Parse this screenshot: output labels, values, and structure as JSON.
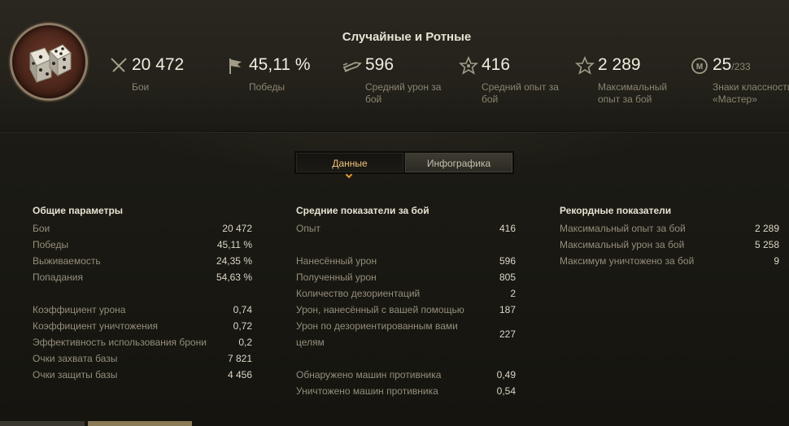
{
  "header": {
    "mode_title": "Случайные и Ротные",
    "stats": [
      {
        "icon": "crossed-swords-icon",
        "value": "20 472",
        "label": "Бои"
      },
      {
        "icon": "flag-icon",
        "value": "45,11 %",
        "label": "Победы"
      },
      {
        "icon": "shell-icon",
        "value": "596",
        "label_line1": "Средний урон за",
        "label_line2": "бой"
      },
      {
        "icon": "star-icon",
        "value": "416",
        "label_line1": "Средний опыт за",
        "label_line2": "бой"
      },
      {
        "icon": "star-outline-icon",
        "value": "2 289",
        "label_line1": "Максимальный",
        "label_line2": "опыт за бой"
      },
      {
        "icon": "mastery-badge-icon",
        "value": "25",
        "value_suffix": "/233",
        "label_line1": "Знаки классности",
        "label_line2": "«Мастер»"
      }
    ]
  },
  "tabs": {
    "data": "Данные",
    "infographic": "Инфографика",
    "active": "data"
  },
  "general": {
    "title": "Общие параметры",
    "rows": [
      {
        "k": "Бои",
        "v": "20 472"
      },
      {
        "k": "Победы",
        "v": "45,11 %"
      },
      {
        "k": "Выживаемость",
        "v": "24,35 %"
      },
      {
        "k": "Попадания",
        "v": "54,63 %"
      },
      {
        "k": "Коэффициент урона",
        "v": "0,74"
      },
      {
        "k": "Коэффициент уничтожения",
        "v": "0,72"
      },
      {
        "k": "Эффективность использования брони",
        "v": "0,2"
      },
      {
        "k": "Очки захвата базы",
        "v": "7 821"
      },
      {
        "k": "Очки защиты базы",
        "v": "4 456"
      }
    ]
  },
  "average": {
    "title": "Средние показатели за бой",
    "rows": [
      {
        "k": "Опыт",
        "v": "416"
      },
      {
        "k": "Нанесённый урон",
        "v": "596"
      },
      {
        "k": "Полученный урон",
        "v": "805"
      },
      {
        "k": "Количество дезориентаций",
        "v": "2"
      },
      {
        "k": "Урон, нанесённый с вашей помощью",
        "v": "187"
      },
      {
        "k": "Урон по дезориентированным вами целям",
        "v": "227"
      },
      {
        "k": "Обнаружено машин противника",
        "v": "0,49"
      },
      {
        "k": "Уничтожено машин противника",
        "v": "0,54"
      }
    ]
  },
  "records": {
    "title": "Рекордные показатели",
    "rows": [
      {
        "k": "Максимальный опыт за бой",
        "v": "2 289"
      },
      {
        "k": "Максимальный урон за бой",
        "v": "5 258"
      },
      {
        "k": "Максимум уничтожено за бой",
        "v": "9"
      }
    ]
  },
  "colors": {
    "accent": "#f2c27a",
    "caret": "#e59a3a",
    "bottom_bar_dark": "#3a372e",
    "bottom_bar_gold": "#8a7a55"
  }
}
